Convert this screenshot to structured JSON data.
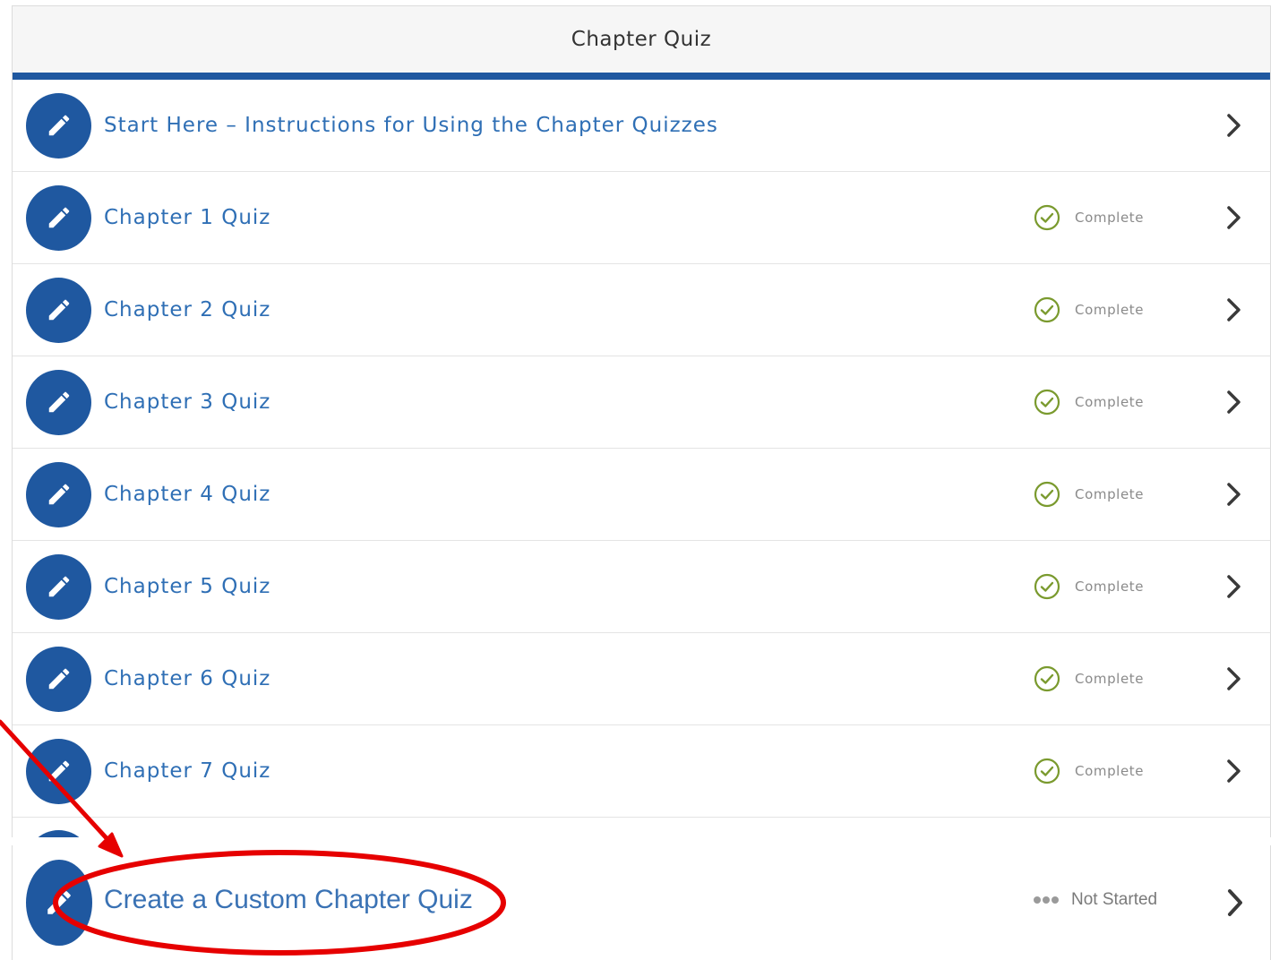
{
  "header": {
    "title": "Chapter Quiz"
  },
  "items": [
    {
      "title": "Start Here – Instructions for Using the Chapter Quizzes",
      "status": ""
    },
    {
      "title": "Chapter 1 Quiz",
      "status": "Complete"
    },
    {
      "title": "Chapter 2 Quiz",
      "status": "Complete"
    },
    {
      "title": "Chapter 3 Quiz",
      "status": "Complete"
    },
    {
      "title": "Chapter 4 Quiz",
      "status": "Complete"
    },
    {
      "title": "Chapter 5 Quiz",
      "status": "Complete"
    },
    {
      "title": "Chapter 6 Quiz",
      "status": "Complete"
    },
    {
      "title": "Chapter 7 Quiz",
      "status": "Complete"
    }
  ],
  "custom_item": {
    "title": "Create a Custom Chapter Quiz",
    "status": "Not Started"
  },
  "icons": {
    "badge": "pencil-icon",
    "complete": "check-circle-icon",
    "not_started": "ellipsis-dots-icon",
    "navigate": "chevron-right-icon"
  },
  "colors": {
    "brand_blue": "#1f58a0",
    "link_blue": "#2f6fb5",
    "complete_green": "#7a9a2e",
    "annotation_red": "#e60000"
  }
}
